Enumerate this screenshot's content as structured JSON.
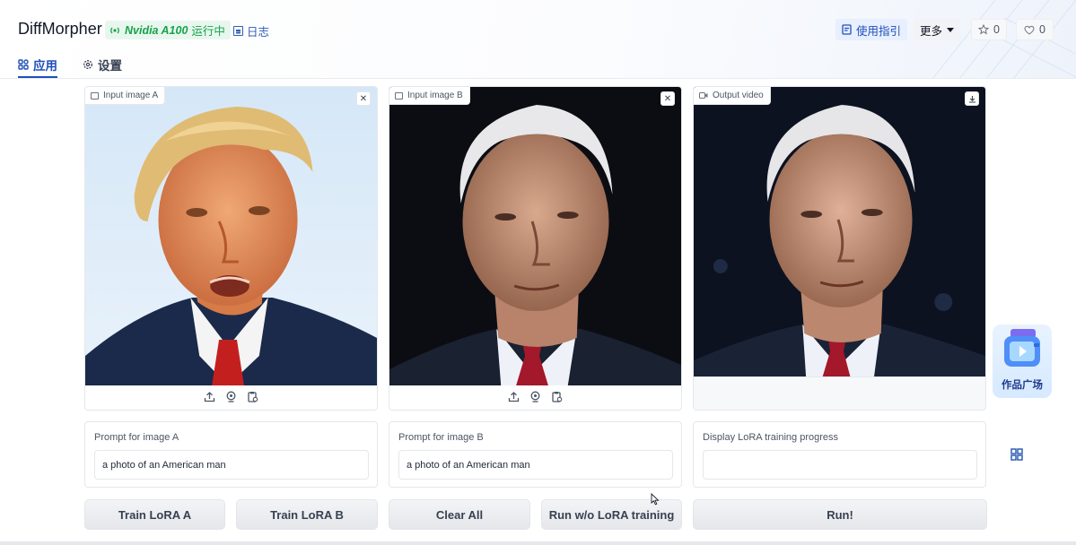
{
  "app": {
    "title": "DiffMorpher",
    "gpu_name": "Nvidia A100",
    "gpu_status": "运行中",
    "log_label": "日志"
  },
  "tabs": [
    {
      "label": "应用",
      "icon": "apps-icon",
      "active": true
    },
    {
      "label": "设置",
      "icon": "gear-icon",
      "active": false
    }
  ],
  "header_actions": {
    "guide_label": "使用指引",
    "more_label": "更多",
    "star_count": "0",
    "like_count": "0"
  },
  "panels": {
    "input_a": {
      "label": "Input image A",
      "icon": "image-icon"
    },
    "input_b": {
      "label": "Input image B",
      "icon": "image-icon"
    },
    "output": {
      "label": "Output video",
      "icon": "video-icon"
    }
  },
  "prompts": {
    "a": {
      "label": "Prompt for image A",
      "value": "a photo of an American man"
    },
    "b": {
      "label": "Prompt for image B",
      "value": "a photo of an American man"
    },
    "progress": {
      "label": "Display LoRA training progress",
      "value": ""
    }
  },
  "buttons": {
    "train_a": "Train LoRA A",
    "train_b": "Train LoRA B",
    "clear": "Clear All",
    "run_wo": "Run w/o LoRA training",
    "run": "Run!"
  },
  "gallery": {
    "label": "作品广场"
  },
  "colors": {
    "accent": "#1e4fb8",
    "gpu_running": "#16a34a",
    "button_bg": "#e5e7eb"
  }
}
